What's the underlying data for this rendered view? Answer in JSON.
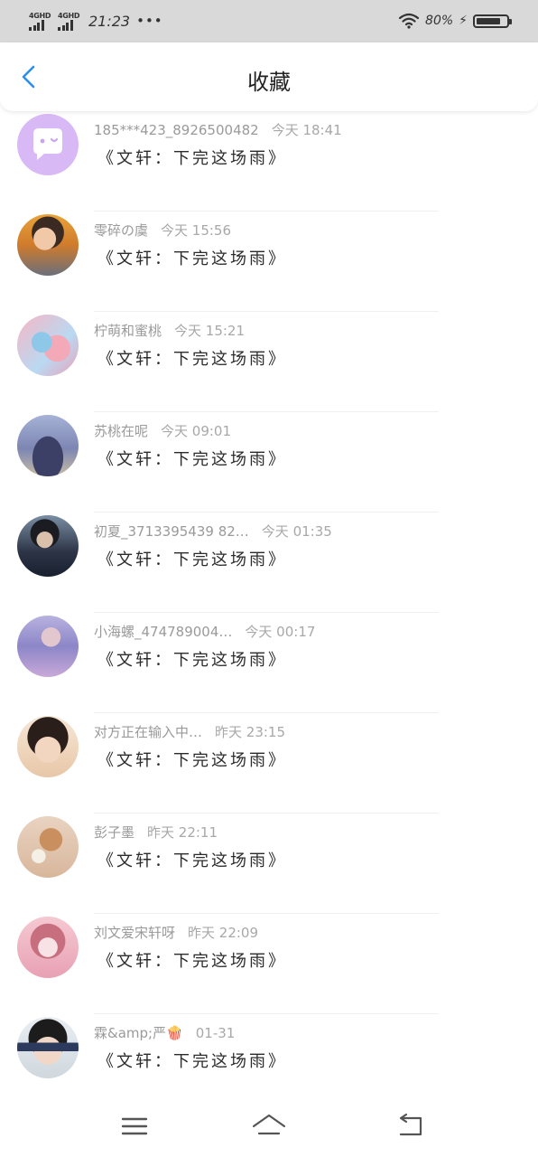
{
  "status_bar": {
    "network1": "4GHD",
    "network2": "4GHD",
    "time": "21:23",
    "dots": "•••",
    "battery_pct": "80%",
    "battery_level": 0.8
  },
  "header": {
    "title": "收藏",
    "back_icon": "chevron-left-icon"
  },
  "accent_color": "#2b8ff0",
  "items": [
    {
      "name": "185***423_8926500482",
      "time": "今天 18:41",
      "message": "《文轩：下完这场雨》",
      "avatar": "chat-bubble-icon"
    },
    {
      "name": "零碎の虞",
      "time": "今天 15:56",
      "message": "《文轩：下完这场雨》",
      "avatar": "photo"
    },
    {
      "name": "柠萌和蜜桃",
      "time": "今天 15:21",
      "message": "《文轩：下完这场雨》",
      "avatar": "photo"
    },
    {
      "name": "苏桃在呢",
      "time": "今天 09:01",
      "message": "《文轩：下完这场雨》",
      "avatar": "photo"
    },
    {
      "name": "初夏_3713395439 82…",
      "time": "今天 01:35",
      "message": "《文轩：下完这场雨》",
      "avatar": "photo"
    },
    {
      "name": "小海螺_474789004…",
      "time": "今天 00:17",
      "message": "《文轩：下完这场雨》",
      "avatar": "photo"
    },
    {
      "name": "对方正在输入中…",
      "time": "昨天 23:15",
      "message": "《文轩：下完这场雨》",
      "avatar": "photo"
    },
    {
      "name": "彭子墨",
      "time": "昨天 22:11",
      "message": "《文轩：下完这场雨》",
      "avatar": "photo"
    },
    {
      "name": "刘文爱宋轩呀",
      "time": "昨天 22:09",
      "message": "《文轩：下完这场雨》",
      "avatar": "photo"
    },
    {
      "name": "霖&amp;严🍿",
      "time": "01-31",
      "message": "《文轩：下完这场雨》",
      "avatar": "photo"
    }
  ],
  "bottom_nav": [
    "menu-icon",
    "home-icon",
    "back-icon"
  ]
}
